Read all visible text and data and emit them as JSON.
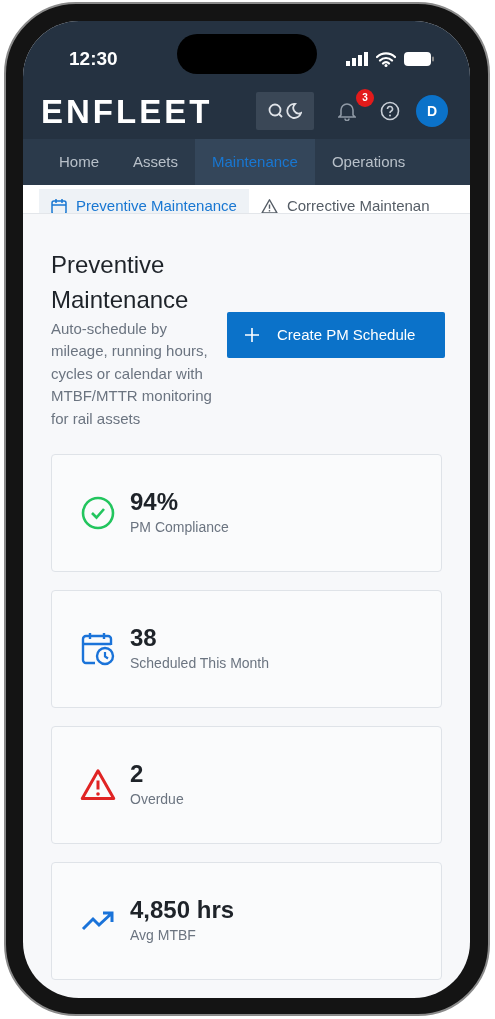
{
  "status_bar": {
    "time": "12:30"
  },
  "header": {
    "logo": "ENFLEET",
    "notifications": "3",
    "avatar": "D"
  },
  "main_nav": [
    {
      "label": "Home",
      "selected": false
    },
    {
      "label": "Assets",
      "selected": false
    },
    {
      "label": "Maintenance",
      "selected": true
    },
    {
      "label": "Operations",
      "selected": false
    }
  ],
  "sub_tabs": [
    {
      "label": "Preventive Maintenance",
      "kind": "calendar",
      "selected": true
    },
    {
      "label": "Corrective Maintenan",
      "kind": "warning",
      "selected": false
    }
  ],
  "page": {
    "title": "Preventive Maintenance",
    "description": "Auto-schedule by mileage, running hours, cycles or calendar with MTBF/MTTR monitoring for rail assets",
    "button": "Create PM Schedule"
  },
  "stats": [
    {
      "kind": "check",
      "color": "#22c55e",
      "value": "94%",
      "label": "PM Compliance"
    },
    {
      "kind": "calendar-clock",
      "color": "#1a73d9",
      "value": "38",
      "label": "Scheduled This Month"
    },
    {
      "kind": "warning",
      "color": "#e02424",
      "value": "2",
      "label": "Overdue"
    },
    {
      "kind": "trend",
      "color": "#1a73d9",
      "value": "4,850 hrs",
      "label": "Avg MTBF"
    }
  ]
}
